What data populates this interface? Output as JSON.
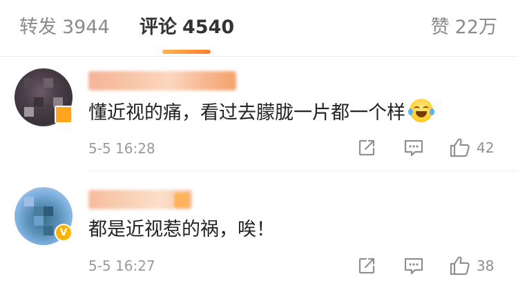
{
  "tabs": {
    "repost": {
      "label": "转发",
      "count": "3944"
    },
    "comments": {
      "label": "评论",
      "count": "4540"
    },
    "likes": {
      "label": "赞",
      "count": "22万"
    }
  },
  "comments": [
    {
      "text": "懂近视的痛，看过去朦胧一片都一个样",
      "emoji": "crying-laughing-emoji",
      "time": "5-5 16:28",
      "like_count": "42"
    },
    {
      "text": "都是近视惹的祸，唉！",
      "verified_badge": "V",
      "time": "5-5 16:27",
      "like_count": "38"
    }
  ],
  "icons": {
    "share": "share-icon",
    "reply": "comment-icon",
    "like": "thumbs-up-icon"
  },
  "colors": {
    "accent": "#ff8a2a",
    "muted_text": "#8a8a8a",
    "primary_text": "#222222",
    "badge": "#ffb300"
  }
}
